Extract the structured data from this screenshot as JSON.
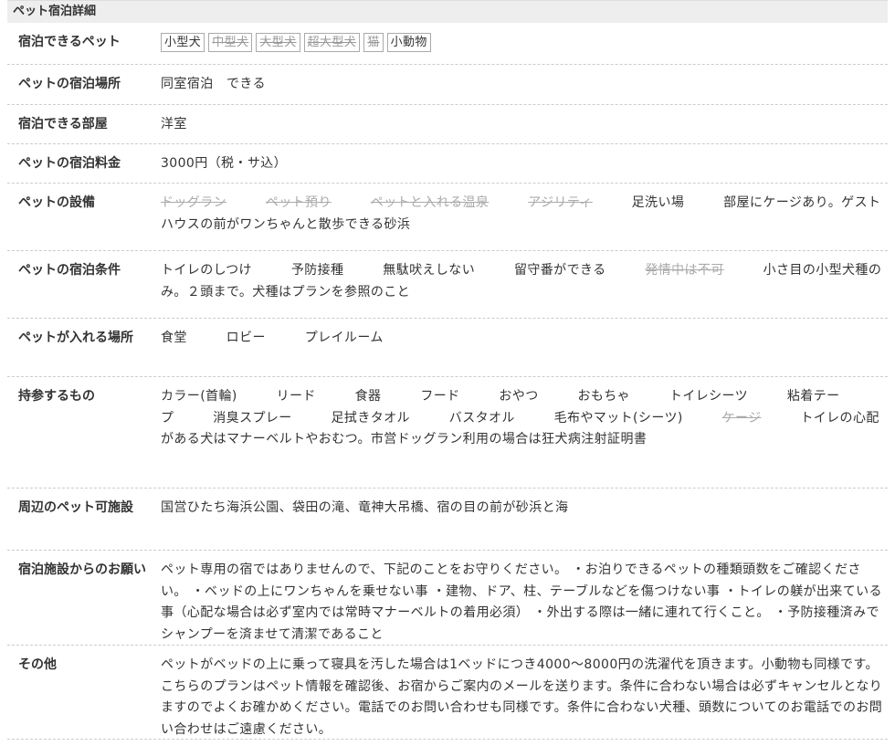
{
  "section_title": "ペット宿泊詳細",
  "rows": {
    "pets": {
      "label": "宿泊できるペット",
      "tags": [
        {
          "text": "小型犬",
          "available": true
        },
        {
          "text": "中型犬",
          "available": false
        },
        {
          "text": "大型犬",
          "available": false
        },
        {
          "text": "超大型犬",
          "available": false
        },
        {
          "text": "猫",
          "available": false
        },
        {
          "text": "小動物",
          "available": true
        }
      ]
    },
    "place": {
      "label": "ペットの宿泊場所",
      "value": "同室宿泊　できる"
    },
    "room": {
      "label": "宿泊できる部屋",
      "value": "洋室"
    },
    "fee": {
      "label": "ペットの宿泊料金",
      "value": "3000円（税・サ込）"
    },
    "facilities": {
      "label": "ペットの設備",
      "items": [
        {
          "text": "ドッグラン",
          "available": false
        },
        {
          "text": "ペット預り",
          "available": false
        },
        {
          "text": "ペットと入れる温泉",
          "available": false
        },
        {
          "text": "アジリティ",
          "available": false
        },
        {
          "text": "足洗い場",
          "available": true
        }
      ],
      "note": "部屋にケージあり。ゲストハウスの前がワンちゃんと散歩できる砂浜"
    },
    "conditions": {
      "label": "ペットの宿泊条件",
      "items": [
        {
          "text": "トイレのしつけ",
          "available": true
        },
        {
          "text": "予防接種",
          "available": true
        },
        {
          "text": "無駄吠えしない",
          "available": true
        },
        {
          "text": "留守番ができる",
          "available": true
        },
        {
          "text": "発情中は不可",
          "available": false
        }
      ],
      "note": "小さ目の小型犬種のみ。２頭まで。犬種はプランを参照のこと"
    },
    "areas": {
      "label": "ペットが入れる場所",
      "items": [
        {
          "text": "食堂",
          "available": true
        },
        {
          "text": "ロビー",
          "available": true
        },
        {
          "text": "プレイルーム",
          "available": true
        }
      ]
    },
    "bring": {
      "label": "持参するもの",
      "items": [
        {
          "text": "カラー(首輪)",
          "available": true
        },
        {
          "text": "リード",
          "available": true
        },
        {
          "text": "食器",
          "available": true
        },
        {
          "text": "フード",
          "available": true
        },
        {
          "text": "おやつ",
          "available": true
        },
        {
          "text": "おもちゃ",
          "available": true
        },
        {
          "text": "トイレシーツ",
          "available": true
        },
        {
          "text": "粘着テープ",
          "available": true
        },
        {
          "text": "消臭スプレー",
          "available": true
        },
        {
          "text": "足拭きタオル",
          "available": true
        },
        {
          "text": "バスタオル",
          "available": true
        },
        {
          "text": "毛布やマット(シーツ)",
          "available": true
        },
        {
          "text": "ケージ",
          "available": false
        }
      ],
      "note": "トイレの心配がある犬はマナーベルトやおむつ。市営ドッグラン利用の場合は狂犬病注射証明書"
    },
    "nearby": {
      "label": "周辺のペット可施設",
      "value": "国営ひたち海浜公園、袋田の滝、竜神大吊橋、宿の目の前が砂浜と海"
    },
    "requests": {
      "label": "宿泊施設からのお願い",
      "value": "ペット専用の宿ではありませんので、下記のことをお守りください。 ・お泊りできるペットの種類頭数をご確認ください。 ・ベッドの上にワンちゃんを乗せない事 ・建物、ドア、柱、テーブルなどを傷つけない事 ・トイレの躾が出来ている事（心配な場合は必ず室内では常時マナーベルトの着用必須） ・外出する際は一緒に連れて行くこと。 ・予防接種済みでシャンプーを済ませて清潔であること"
    },
    "other": {
      "label": "その他",
      "value": "ペットがベッドの上に乗って寝具を汚した場合は1ベッドにつき4000～8000円の洗濯代を頂きます。小動物も同様です。 こちらのプランはペット情報を確認後、お宿からご案内のメールを送ります。条件に合わない場合は必ずキャンセルとなりますのでよくお確かめください。電話でのお問い合わせも同様です。条件に合わない犬種、頭数についてのお電話でのお問い合わせはご遠慮ください。"
    }
  }
}
